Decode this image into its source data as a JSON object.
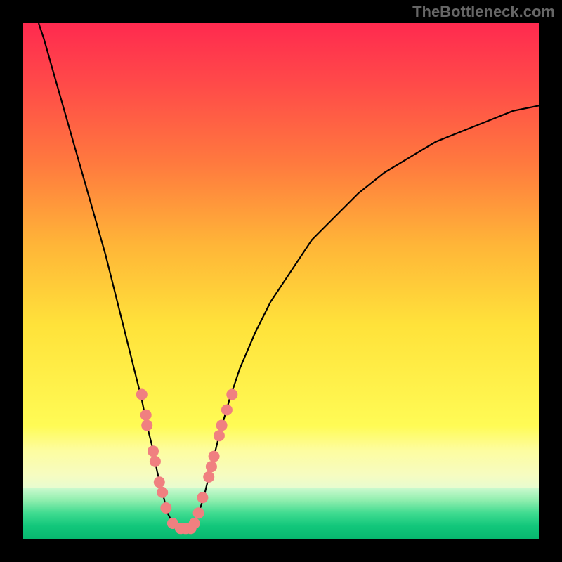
{
  "watermark": "TheBottleneck.com",
  "colors": {
    "frame": "#000000",
    "curve": "#000000",
    "marker_fill": "#f08080",
    "marker_stroke": "#cc5f5f"
  },
  "chart_data": {
    "type": "line",
    "title": "",
    "xlabel": "",
    "ylabel": "",
    "xlim": [
      0,
      100
    ],
    "ylim": [
      0,
      100
    ],
    "curve": [
      {
        "x": 3,
        "y": 100
      },
      {
        "x": 4,
        "y": 97
      },
      {
        "x": 6,
        "y": 90
      },
      {
        "x": 8,
        "y": 83
      },
      {
        "x": 10,
        "y": 76
      },
      {
        "x": 12,
        "y": 69
      },
      {
        "x": 14,
        "y": 62
      },
      {
        "x": 16,
        "y": 55
      },
      {
        "x": 18,
        "y": 47
      },
      {
        "x": 20,
        "y": 39
      },
      {
        "x": 22,
        "y": 31
      },
      {
        "x": 23,
        "y": 27
      },
      {
        "x": 24,
        "y": 22
      },
      {
        "x": 25,
        "y": 18
      },
      {
        "x": 26,
        "y": 13
      },
      {
        "x": 27,
        "y": 9
      },
      {
        "x": 28,
        "y": 5
      },
      {
        "x": 29,
        "y": 3
      },
      {
        "x": 30,
        "y": 2
      },
      {
        "x": 31,
        "y": 2
      },
      {
        "x": 32,
        "y": 2
      },
      {
        "x": 33,
        "y": 3
      },
      {
        "x": 34,
        "y": 5
      },
      {
        "x": 35,
        "y": 8
      },
      {
        "x": 36,
        "y": 12
      },
      {
        "x": 37,
        "y": 16
      },
      {
        "x": 38,
        "y": 20
      },
      {
        "x": 40,
        "y": 27
      },
      {
        "x": 42,
        "y": 33
      },
      {
        "x": 45,
        "y": 40
      },
      {
        "x": 48,
        "y": 46
      },
      {
        "x": 52,
        "y": 52
      },
      {
        "x": 56,
        "y": 58
      },
      {
        "x": 60,
        "y": 62
      },
      {
        "x": 65,
        "y": 67
      },
      {
        "x": 70,
        "y": 71
      },
      {
        "x": 75,
        "y": 74
      },
      {
        "x": 80,
        "y": 77
      },
      {
        "x": 85,
        "y": 79
      },
      {
        "x": 90,
        "y": 81
      },
      {
        "x": 95,
        "y": 83
      },
      {
        "x": 100,
        "y": 84
      }
    ],
    "markers": [
      {
        "x": 23.0,
        "y": 28
      },
      {
        "x": 23.8,
        "y": 24
      },
      {
        "x": 24.0,
        "y": 22
      },
      {
        "x": 25.2,
        "y": 17
      },
      {
        "x": 25.6,
        "y": 15
      },
      {
        "x": 26.4,
        "y": 11
      },
      {
        "x": 27.0,
        "y": 9
      },
      {
        "x": 27.7,
        "y": 6
      },
      {
        "x": 29.0,
        "y": 3
      },
      {
        "x": 30.5,
        "y": 2
      },
      {
        "x": 31.5,
        "y": 2
      },
      {
        "x": 32.5,
        "y": 2
      },
      {
        "x": 33.2,
        "y": 3
      },
      {
        "x": 34.0,
        "y": 5
      },
      {
        "x": 34.8,
        "y": 8
      },
      {
        "x": 36.0,
        "y": 12
      },
      {
        "x": 36.5,
        "y": 14
      },
      {
        "x": 37.0,
        "y": 16
      },
      {
        "x": 38.0,
        "y": 20
      },
      {
        "x": 38.5,
        "y": 22
      },
      {
        "x": 39.5,
        "y": 25
      },
      {
        "x": 40.5,
        "y": 28
      }
    ]
  }
}
